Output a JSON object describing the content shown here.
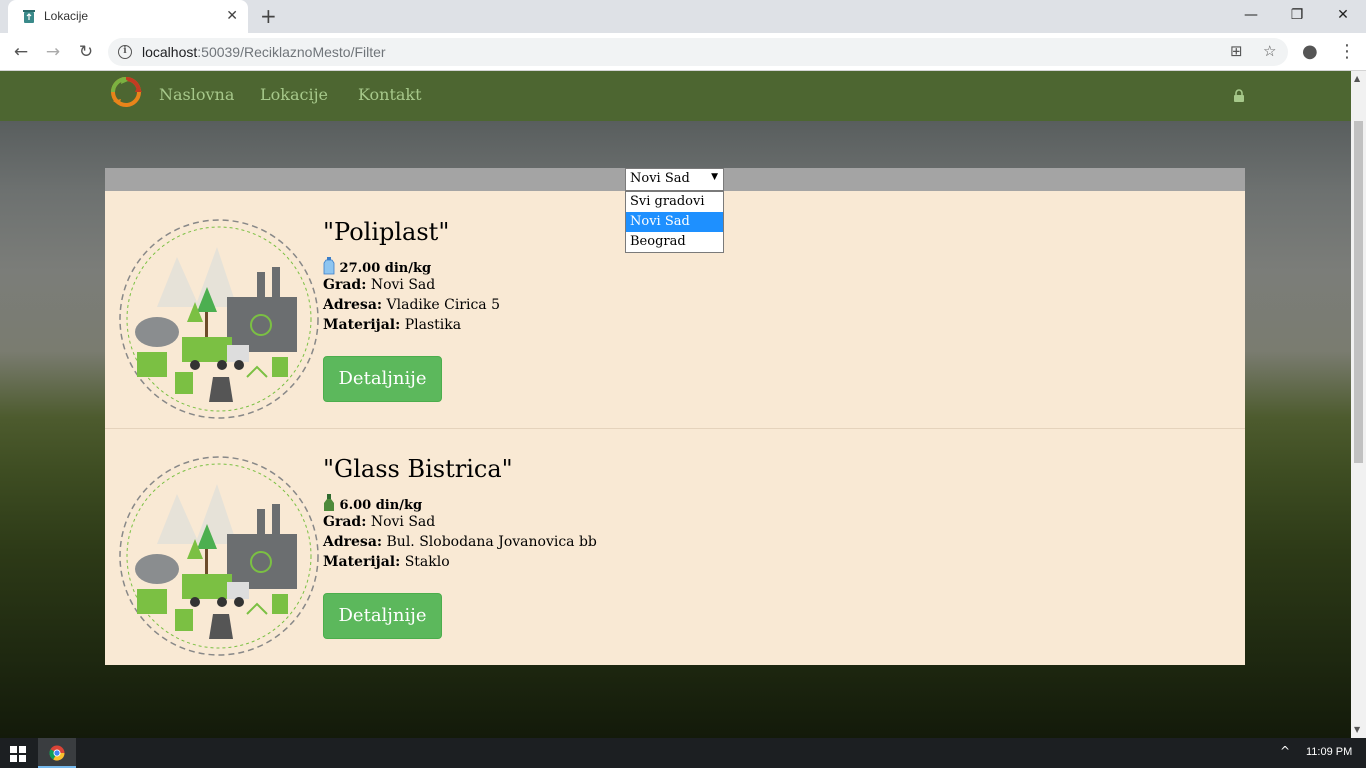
{
  "browser": {
    "tab_title": "Lokacije",
    "url_host": "localhost",
    "url_path": ":50039/ReciklaznoMesto/Filter",
    "icons": [
      "back-icon",
      "forward-icon",
      "reload-icon",
      "info-icon",
      "translate-icon",
      "star-icon",
      "account-icon",
      "menu-icon"
    ]
  },
  "navbar": {
    "links": [
      "Naslovna",
      "Lokacije",
      "Kontakt"
    ],
    "colors": {
      "bg": "#4d6631",
      "link": "#a6c88a"
    }
  },
  "filter": {
    "selected": "Novi Sad",
    "options": [
      "Svi gradovi",
      "Novi Sad",
      "Beograd"
    ]
  },
  "labels": {
    "grad": "Grad:",
    "adresa": "Adresa:",
    "materijal": "Materijal:",
    "button": "Detaljnije"
  },
  "locations": [
    {
      "title": "\"Poliplast\"",
      "price": "27.00 din/kg",
      "price_icon": "bottle-icon",
      "grad": "Novi Sad",
      "adresa": "Vladike Cirica 5",
      "materijal": "Plastika"
    },
    {
      "title": "\"Glass Bistrica\"",
      "price": "6.00 din/kg",
      "price_icon": "glass-bottle-icon",
      "grad": "Novi Sad",
      "adresa": "Bul. Slobodana Jovanovica bb",
      "materijal": "Staklo"
    }
  ],
  "taskbar": {
    "time": "11:09 PM"
  }
}
